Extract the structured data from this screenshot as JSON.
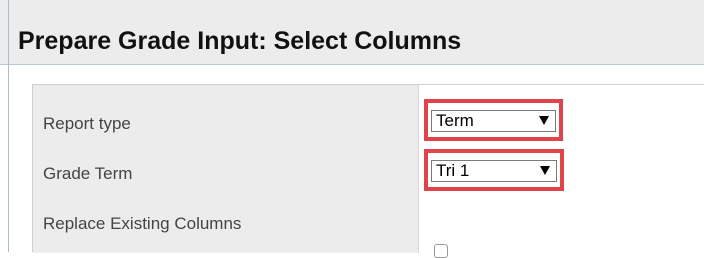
{
  "title": "Prepare Grade Input: Select Columns",
  "form": {
    "rows": [
      {
        "label": "Report type",
        "value": "Term"
      },
      {
        "label": "Grade Term",
        "value": "Tri 1"
      },
      {
        "label": "Replace Existing Columns",
        "checked": false
      }
    ]
  },
  "colors": {
    "highlight": "#e0434a",
    "header_bg": "#ececec",
    "label_bg": "#ececec"
  },
  "icons": {
    "dropdown": "triangle-down"
  }
}
